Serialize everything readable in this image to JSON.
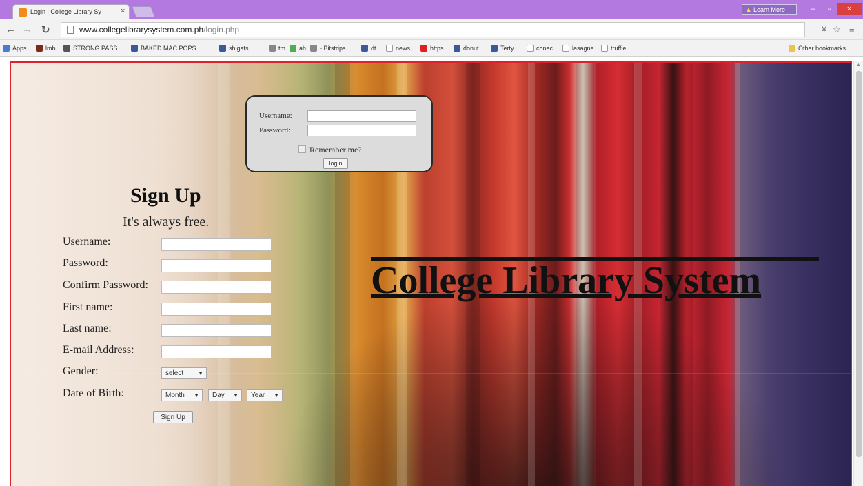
{
  "browser": {
    "tab_title": "Login | College Library Sy",
    "tab_close": "×",
    "learn_more": "Learn More",
    "window_controls": {
      "minimize": "–",
      "maximize": "▫",
      "close": "×"
    },
    "url_host": "www.collegelibrarysystem.com.ph",
    "url_path": "/login.php",
    "bookmarks": [
      "Apps",
      "lmb",
      "STRONG PASS",
      "BAKED MAC POPS",
      "shigats",
      "tm",
      "ah",
      "- Bitstrips",
      "dt",
      "news",
      "https",
      "donut",
      "Terty",
      "conec",
      "lasagne",
      "truffle"
    ],
    "other_bookmarks": "Other bookmarks",
    "colors": {
      "titlebar": "#b479e0",
      "close_button": "#d94141"
    }
  },
  "login": {
    "username_label": "Username:",
    "password_label": "Password:",
    "remember_label": "Remember me?",
    "button": "login"
  },
  "signup": {
    "title": "Sign Up",
    "subtitle": "It's always free.",
    "fields": {
      "username": "Username:",
      "password": "Password:",
      "confirm_password": "Confirm Password:",
      "first_name": "First name:",
      "last_name": "Last name:",
      "email": "E-mail Address:",
      "gender": "Gender:",
      "dob": "Date of Birth:"
    },
    "gender_select": "select",
    "month_select": "Month",
    "day_select": "Day",
    "year_select": "Year",
    "button": "Sign Up"
  },
  "headline": "College Library System",
  "accent_color": "#e0202a"
}
